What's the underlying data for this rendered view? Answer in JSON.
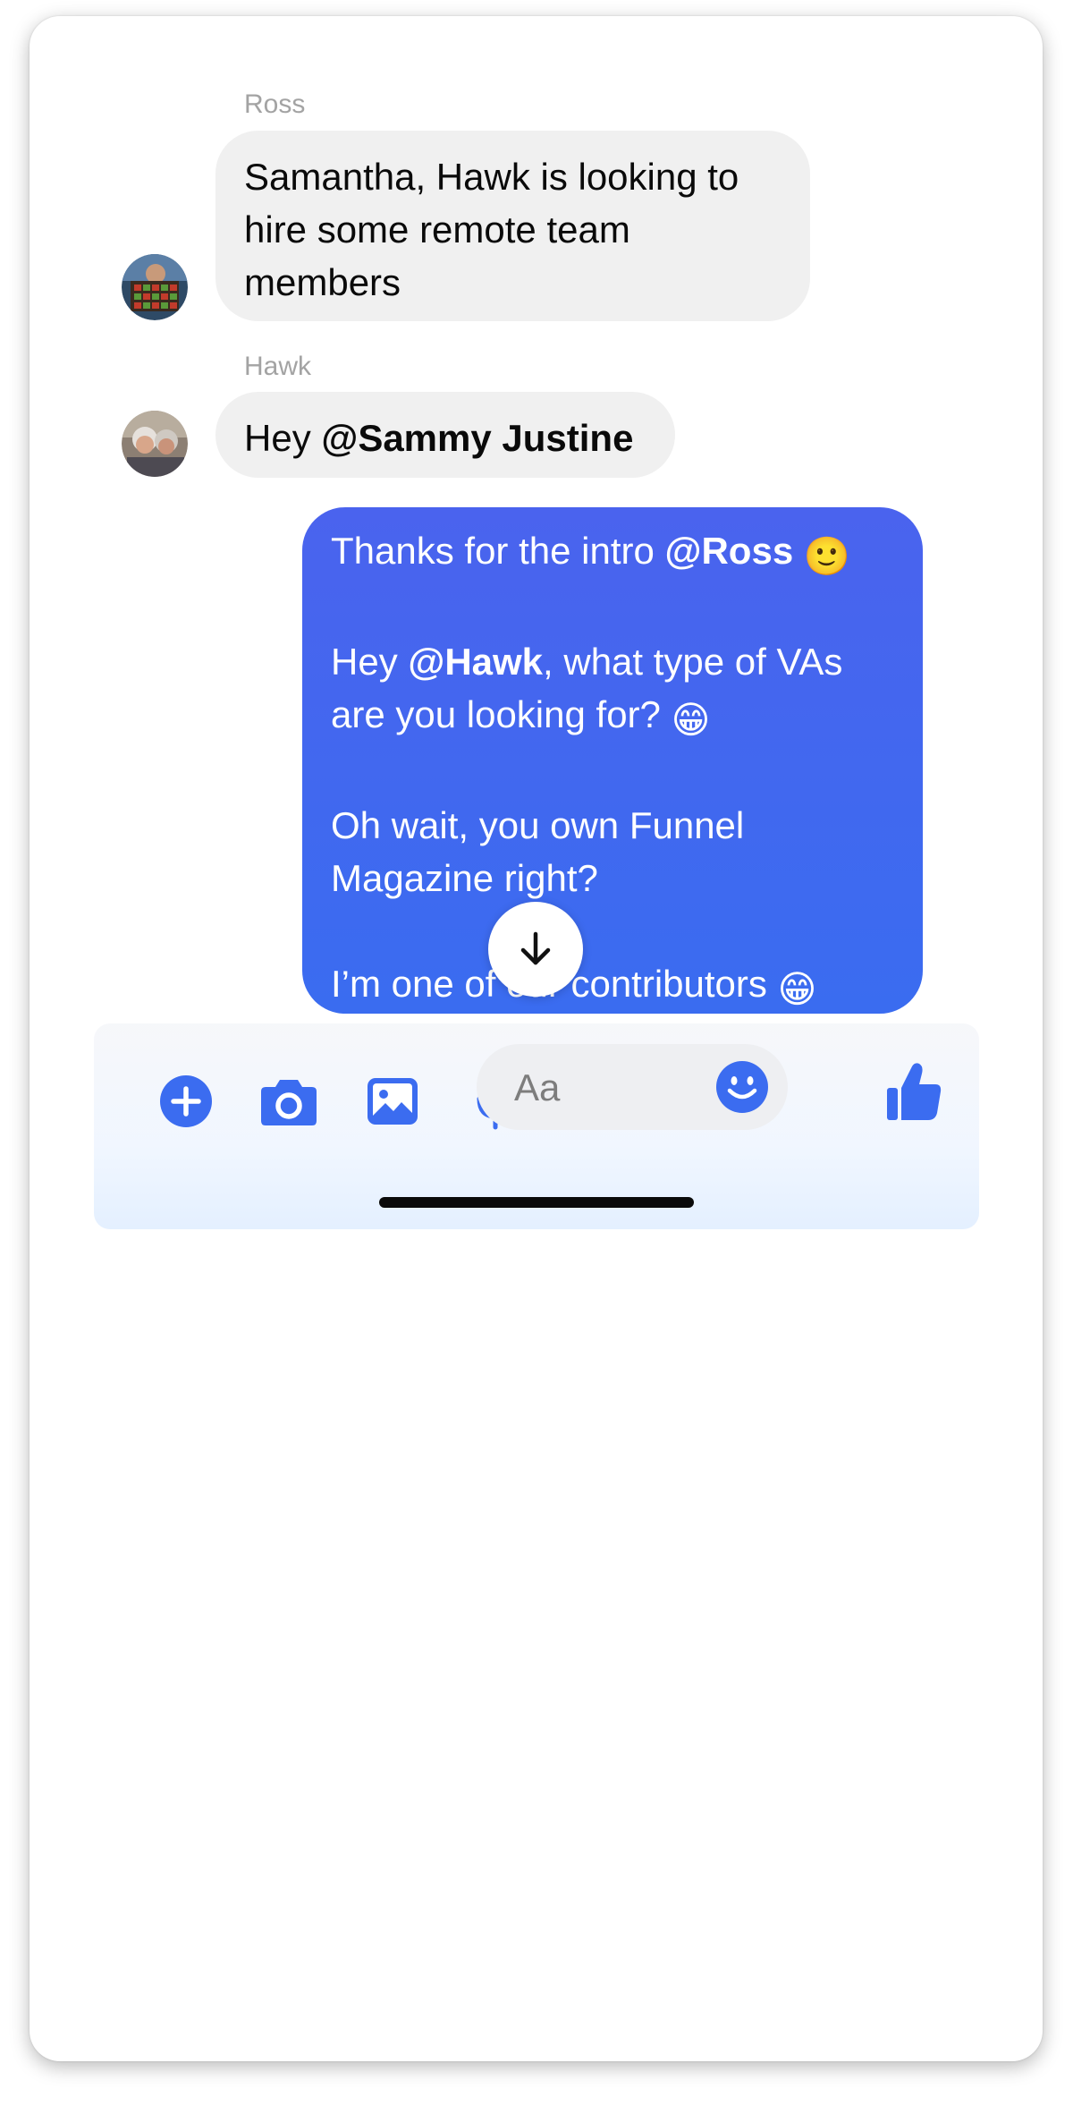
{
  "conversation": {
    "messages": [
      {
        "sender": "Ross",
        "text": "Samantha, Hawk is looking to hire some remote team members"
      },
      {
        "sender": "Hawk",
        "text_prefix": "Hey ",
        "mention": "@Sammy Justine"
      }
    ],
    "outgoing": {
      "p1_prefix": "Thanks for the intro ",
      "p1_mention": "@Ross",
      "p1_emoji": "🙂",
      "p2_prefix": "Hey ",
      "p2_mention": "@Hawk",
      "p2_suffix": ", what type of VAs are you looking for? ",
      "p2_emoji": "😁",
      "p3": "Oh wait, you own Funnel Magazine right?",
      "p4": "I’m one of our contributors ",
      "p4_emoji": "😁"
    }
  },
  "composer": {
    "placeholder": "Aa"
  },
  "icons": {
    "scroll": "arrow-down-icon",
    "add": "plus-circle-icon",
    "camera": "camera-icon",
    "gallery": "image-icon",
    "mic": "microphone-icon",
    "emoji": "smiley-icon",
    "like": "thumbs-up-icon"
  },
  "colors": {
    "accent": "#3b6cf0",
    "outgoing_bubble": "#4365ef",
    "incoming_bubble": "#f0f0f0",
    "sender_label": "#a3a3a3"
  }
}
